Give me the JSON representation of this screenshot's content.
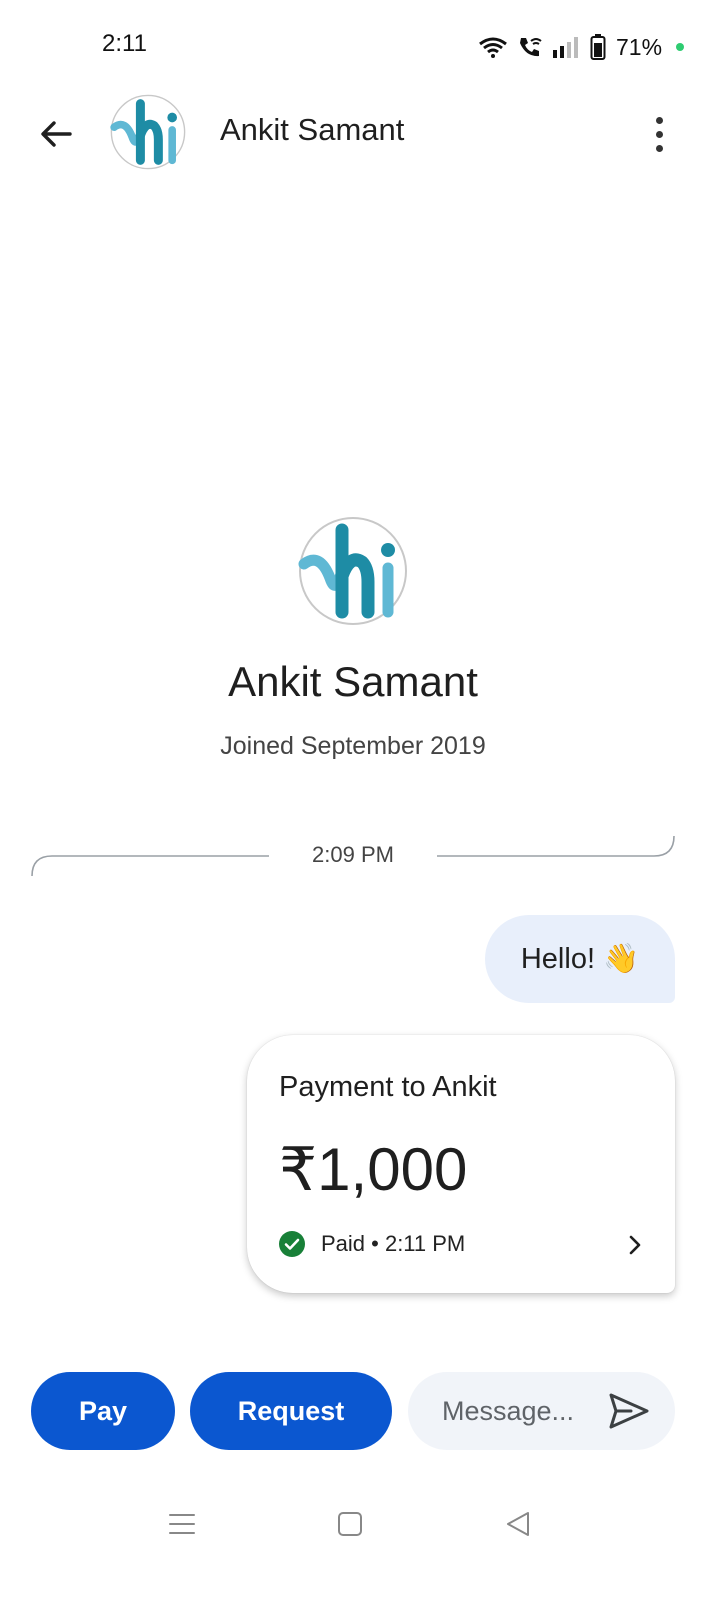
{
  "status_bar": {
    "time": "2:11",
    "battery": "71%",
    "icons": [
      "wifi-icon",
      "wifi-calling-icon",
      "signal-icon",
      "battery-icon"
    ]
  },
  "header": {
    "title": "Ankit Samant",
    "back_icon": "arrow-back-icon",
    "more_icon": "more-vert-icon"
  },
  "profile": {
    "name": "Ankit Samant",
    "joined": "Joined September 2019"
  },
  "chat": {
    "divider_time": "2:09 PM",
    "messages": [
      {
        "text": "Hello!",
        "emoji": "👋"
      }
    ],
    "payment": {
      "title": "Payment to Ankit",
      "amount": "₹1,000",
      "status": "Paid • 2:11 PM",
      "status_color": "#188038"
    }
  },
  "actions": {
    "pay_label": "Pay",
    "request_label": "Request",
    "message_placeholder": "Message..."
  },
  "colors": {
    "primary": "#0b57d0",
    "bubble": "#e8effb",
    "input_bg": "#f1f4f9",
    "paid_green": "#188038"
  }
}
